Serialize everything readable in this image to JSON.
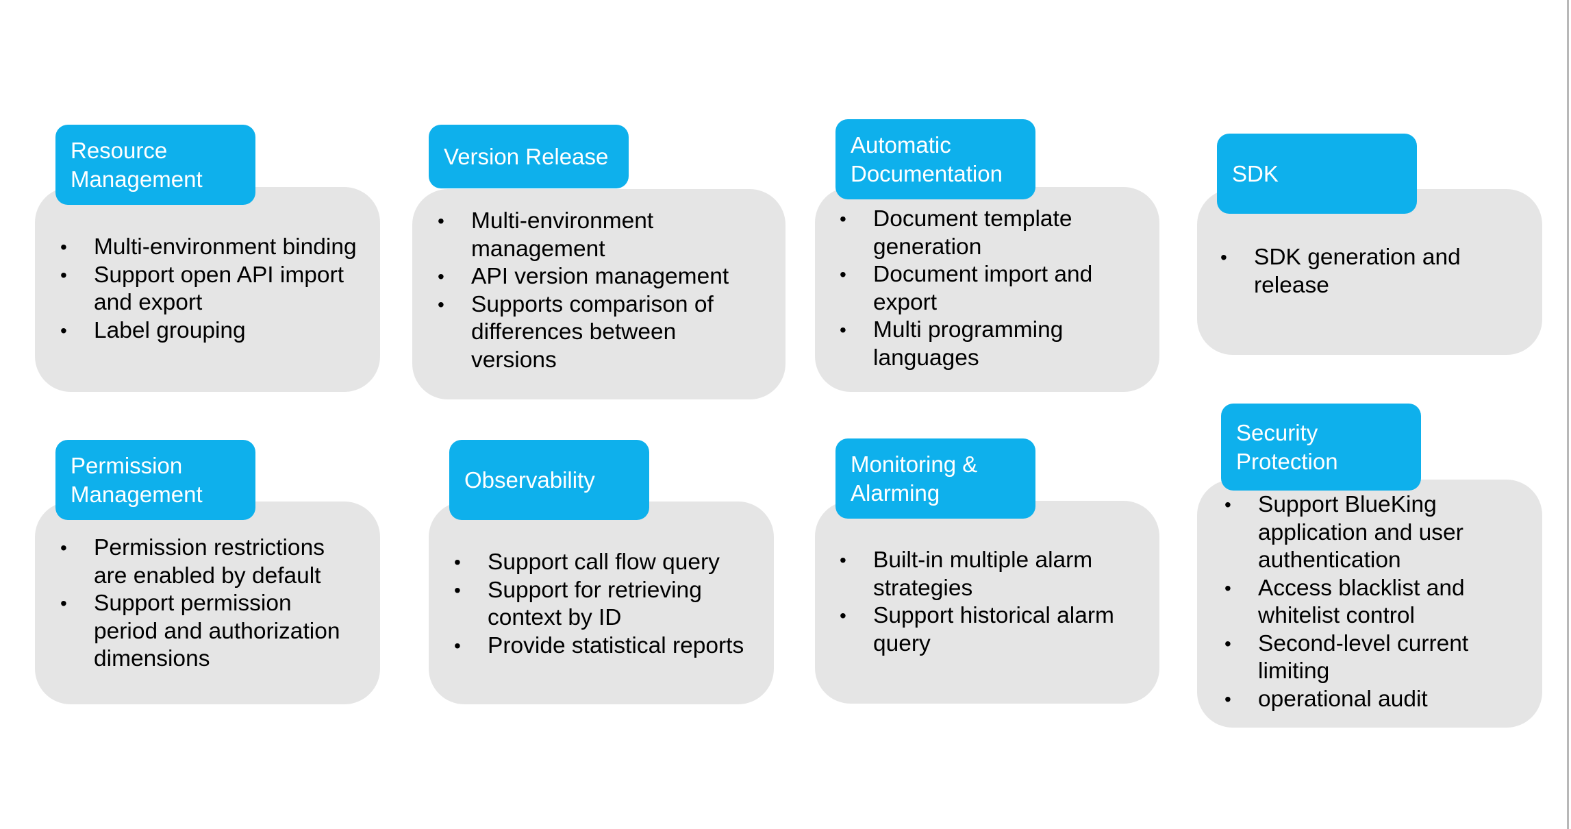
{
  "colors": {
    "header_bg": "#0eb0ec",
    "body_bg": "#e5e5e5",
    "header_text": "#ffffff",
    "body_text": "#000000"
  },
  "bullet_glyph": "•",
  "cards": [
    {
      "title": "Resource Management",
      "items": [
        "Multi-environment binding",
        "Support open API import and export",
        "Label grouping"
      ]
    },
    {
      "title": "Version Release",
      "items": [
        "Multi-environment management",
        "API version management",
        "Supports comparison of differences between versions"
      ]
    },
    {
      "title": "Automatic Documentation",
      "items": [
        "Document template generation",
        "Document import and export",
        "Multi programming languages"
      ]
    },
    {
      "title": "SDK",
      "items": [
        "SDK generation and release"
      ]
    },
    {
      "title": "Permission Management",
      "items": [
        "Permission restrictions are enabled by default",
        "Support permission period and authorization dimensions"
      ]
    },
    {
      "title": "Observability",
      "items": [
        "Support call flow query",
        "Support for retrieving context by ID",
        "Provide statistical reports"
      ]
    },
    {
      "title": "Monitoring & Alarming",
      "items": [
        "Built-in multiple alarm strategies",
        "Support historical alarm query"
      ]
    },
    {
      "title": "Security Protection",
      "items": [
        "Support BlueKing application and user authentication",
        "Access blacklist and whitelist control",
        "Second-level current limiting",
        "operational audit"
      ]
    }
  ]
}
